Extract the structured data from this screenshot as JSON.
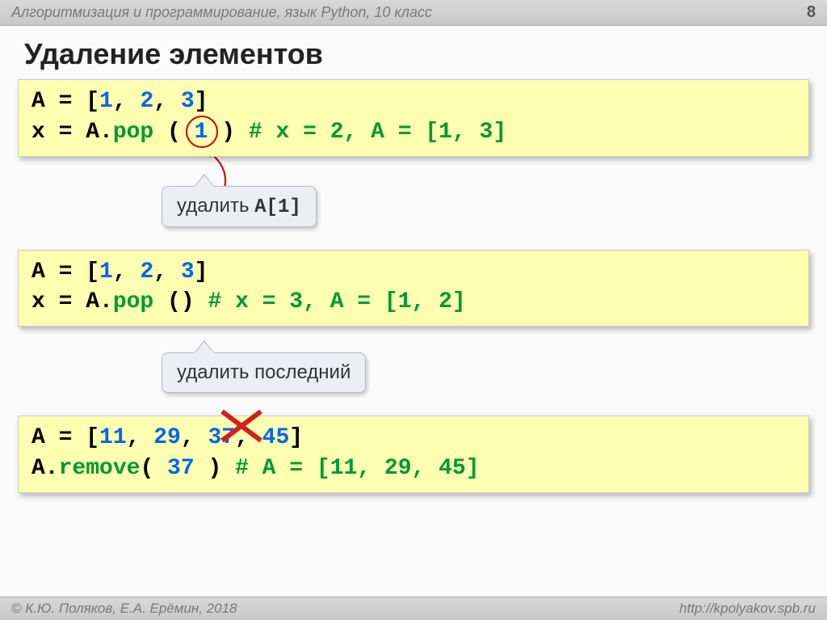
{
  "header": {
    "breadcrumb": "Алгоритмизация и программирование, язык Python, 10 класс",
    "page_number": "8"
  },
  "title": "Удаление элементов",
  "block1": {
    "line1_pre": "A = [",
    "line1_n1": "1",
    "line1_c1": ", ",
    "line1_n2": "2",
    "line1_c2": ", ",
    "line1_n3": "3",
    "line1_post": "]",
    "line2_pre": "x = A.",
    "line2_method": "pop",
    "line2_open": " ( ",
    "line2_arg": "1",
    "line2_close": " )   ",
    "line2_comment": "# x = 2, A = [1, 3]"
  },
  "callout1": {
    "text_pre": "удалить ",
    "text_code": "A[1]"
  },
  "block2": {
    "line1_pre": "A = [",
    "line1_n1": "1",
    "line1_c1": ", ",
    "line1_n2": "2",
    "line1_c2": ", ",
    "line1_n3": "3",
    "line1_post": "]",
    "line2_pre": "x = A.",
    "line2_method": "pop",
    "line2_paren": " ()  ",
    "line2_comment": "# x = 3, A = [1, 2]"
  },
  "callout2": {
    "text": "удалить последний"
  },
  "block3": {
    "line1_pre": "A = [",
    "line1_n1": "11",
    "line1_c1": ", ",
    "line1_n2": "29",
    "line1_c2": ", ",
    "line1_n3": "37",
    "line1_c3": ", ",
    "line1_n4": "45",
    "line1_post": "]",
    "line2_pre": "A.",
    "line2_method": "remove",
    "line2_open": "( ",
    "line2_arg": "37",
    "line2_close": " )  ",
    "line2_comment": "# A = [11, 29, 45]"
  },
  "footer": {
    "copyright": "© К.Ю. Поляков, Е.А. Ерёмин, 2018",
    "url": "http://kpolyakov.spb.ru"
  }
}
